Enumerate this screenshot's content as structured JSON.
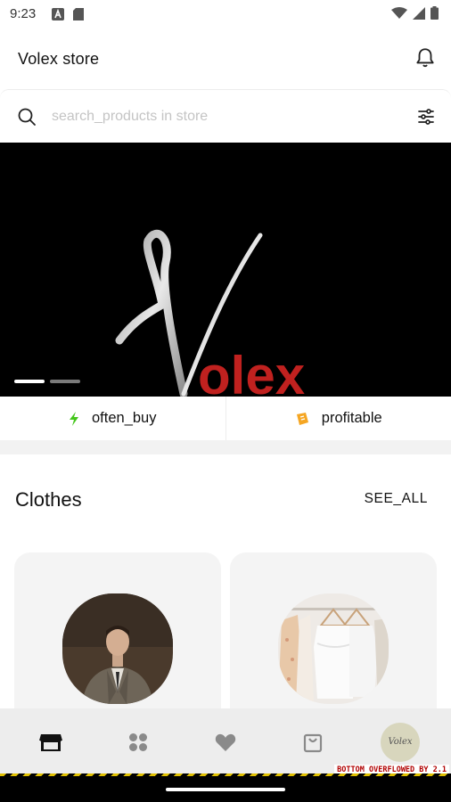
{
  "status_bar": {
    "time": "9:23"
  },
  "app_bar": {
    "title": "Volex store"
  },
  "search": {
    "placeholder": "search_products in store"
  },
  "banner": {
    "logo_text": "Volex",
    "active_slide": 1,
    "slide_count": 2
  },
  "quick_actions": [
    {
      "label": "often_buy",
      "icon": "lightning-icon",
      "color": "#43c61a"
    },
    {
      "label": "profitable",
      "icon": "coupon-icon",
      "color": "#f5a623"
    }
  ],
  "section": {
    "title": "Clothes",
    "see_all_label": "SEE_ALL"
  },
  "products": [
    {
      "image": "suit-man-photo"
    },
    {
      "image": "white-dresses-on-hangers-photo"
    }
  ],
  "bottom_nav": [
    {
      "icon": "store-icon",
      "active": true
    },
    {
      "icon": "categories-icon",
      "active": false
    },
    {
      "icon": "heart-icon",
      "active": false
    },
    {
      "icon": "shopping-bag-icon",
      "active": false
    },
    {
      "icon": "avatar",
      "label": "Volex"
    }
  ],
  "debug": {
    "overflow_text": "BOTTOM OVERFLOWED BY 2.1"
  },
  "colors": {
    "banner_bg": "#000000",
    "logo_red": "#c0211f",
    "page_bg": "#ffffff"
  }
}
